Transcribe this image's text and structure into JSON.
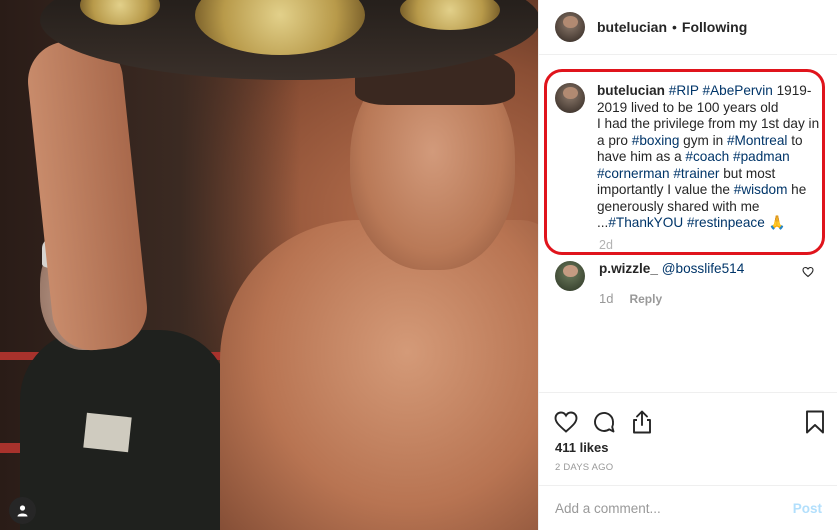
{
  "post": {
    "author": "butelucian",
    "separator": "•",
    "follow_state": "Following"
  },
  "caption": {
    "username": "butelucian",
    "segments": [
      {
        "text": "#RIP",
        "tag": true
      },
      {
        "text": " ",
        "tag": false
      },
      {
        "text": "#AbePervin",
        "tag": true
      },
      {
        "text": " 1919-2019 lived to be 100 years old",
        "tag": false
      },
      {
        "text": "\nI had the privilege from my 1st day in a pro ",
        "tag": false
      },
      {
        "text": "#boxing",
        "tag": true
      },
      {
        "text": " gym in ",
        "tag": false
      },
      {
        "text": "#Montreal",
        "tag": true
      },
      {
        "text": " to have him as a ",
        "tag": false
      },
      {
        "text": "#coach",
        "tag": true
      },
      {
        "text": " ",
        "tag": false
      },
      {
        "text": "#padman",
        "tag": true
      },
      {
        "text": " ",
        "tag": false
      },
      {
        "text": "#cornerman",
        "tag": true
      },
      {
        "text": " ",
        "tag": false
      },
      {
        "text": "#trainer",
        "tag": true
      },
      {
        "text": " but most importantly I value the ",
        "tag": false
      },
      {
        "text": "#wisdom",
        "tag": true
      },
      {
        "text": " he generously shared with me ...",
        "tag": false
      },
      {
        "text": "#ThankYOU",
        "tag": true
      },
      {
        "text": " ",
        "tag": false
      },
      {
        "text": "#restinpeace",
        "tag": true
      },
      {
        "text": " 🙏",
        "tag": false
      }
    ],
    "time": "2d"
  },
  "comments": [
    {
      "username": "p.wizzle_",
      "mention": "@bosslife514",
      "time": "1d",
      "reply_label": "Reply"
    }
  ],
  "likes": "411 likes",
  "date": "2 DAYS AGO",
  "add_comment": {
    "placeholder": "Add a comment...",
    "post_label": "Post"
  },
  "icons": {
    "like": "heart-icon",
    "comment": "comment-bubble-icon",
    "share": "share-icon",
    "save": "bookmark-icon",
    "user_tags": "user-tag-icon"
  },
  "colors": {
    "highlight": "#e0141c",
    "hashtag": "#003569",
    "muted": "#999999",
    "post_disabled": "#b2dffc"
  }
}
